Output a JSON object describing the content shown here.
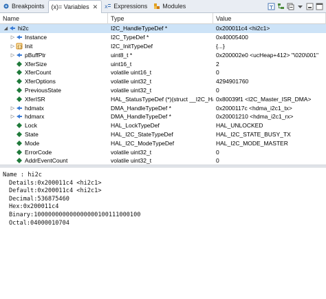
{
  "tabs": [
    {
      "label": "Breakpoints",
      "icon": "breakpoint-icon",
      "active": false
    },
    {
      "label": "(x)= Variables",
      "icon": "variables-icon",
      "active": true,
      "close": "✕"
    },
    {
      "label": "Expressions",
      "icon": "expressions-icon",
      "active": false
    },
    {
      "label": "Modules",
      "icon": "modules-icon",
      "active": false
    }
  ],
  "toolbar": [
    "show-type-names-icon",
    "show-logical-structure-icon",
    "collapse-all-icon",
    "new-window-icon",
    "minimize-icon",
    "maximize-icon"
  ],
  "columns": {
    "name": "Name",
    "type": "Type",
    "value": "Value"
  },
  "rows": [
    {
      "depth": 0,
      "arrow": "◢",
      "icon": "pointer",
      "name": "hi2c",
      "type": "I2C_HandleTypeDef *",
      "value": "0x200011c4 <hi2c1>",
      "selected": true
    },
    {
      "depth": 1,
      "arrow": "▷",
      "icon": "pointer",
      "name": "Instance",
      "type": "I2C_TypeDef *",
      "value": "0x40005400"
    },
    {
      "depth": 1,
      "arrow": "▷",
      "icon": "struct",
      "name": "Init",
      "type": "I2C_InitTypeDef",
      "value": "{...}"
    },
    {
      "depth": 1,
      "arrow": "▷",
      "icon": "pointer",
      "name": "pBuffPtr",
      "type": "uint8_t *",
      "value": "0x200002e0 <ucHeap+412> \"\\020\\001\""
    },
    {
      "depth": 1,
      "arrow": "",
      "icon": "field",
      "name": "XferSize",
      "type": "uint16_t",
      "value": "2"
    },
    {
      "depth": 1,
      "arrow": "",
      "icon": "field",
      "name": "XferCount",
      "type": "volatile uint16_t",
      "value": "0"
    },
    {
      "depth": 1,
      "arrow": "",
      "icon": "field",
      "name": "XferOptions",
      "type": "volatile uint32_t",
      "value": "4294901760"
    },
    {
      "depth": 1,
      "arrow": "",
      "icon": "field",
      "name": "PreviousState",
      "type": "volatile uint32_t",
      "value": "0"
    },
    {
      "depth": 1,
      "arrow": "",
      "icon": "field",
      "name": "XferISR",
      "type": "HAL_StatusTypeDef (*)(struct __I2C_Ha...",
      "value": "0x80039f1 <I2C_Master_ISR_DMA>"
    },
    {
      "depth": 1,
      "arrow": "▷",
      "icon": "pointer",
      "name": "hdmatx",
      "type": "DMA_HandleTypeDef *",
      "value": "0x2000117c <hdma_i2c1_tx>"
    },
    {
      "depth": 1,
      "arrow": "▷",
      "icon": "pointer",
      "name": "hdmarx",
      "type": "DMA_HandleTypeDef *",
      "value": "0x20001210 <hdma_i2c1_rx>"
    },
    {
      "depth": 1,
      "arrow": "",
      "icon": "field",
      "name": "Lock",
      "type": "HAL_LockTypeDef",
      "value": "HAL_UNLOCKED"
    },
    {
      "depth": 1,
      "arrow": "",
      "icon": "field",
      "name": "State",
      "type": "HAL_I2C_StateTypeDef",
      "value": "HAL_I2C_STATE_BUSY_TX"
    },
    {
      "depth": 1,
      "arrow": "",
      "icon": "field",
      "name": "Mode",
      "type": "HAL_I2C_ModeTypeDef",
      "value": "HAL_I2C_MODE_MASTER"
    },
    {
      "depth": 1,
      "arrow": "",
      "icon": "field",
      "name": "ErrorCode",
      "type": "volatile uint32_t",
      "value": "0"
    },
    {
      "depth": 1,
      "arrow": "",
      "icon": "field",
      "name": "AddrEventCount",
      "type": "volatile uint32_t",
      "value": "0"
    }
  ],
  "details": [
    {
      "text": "Name : hi2c",
      "indent": false
    },
    {
      "text": "Details:0x200011c4 <hi2c1>",
      "indent": true
    },
    {
      "text": "Default:0x200011c4 <hi2c1>",
      "indent": true
    },
    {
      "text": "Decimal:536875460",
      "indent": true
    },
    {
      "text": "Hex:0x200011c4",
      "indent": true
    },
    {
      "text": "Binary:100000000000000000100111000100",
      "indent": true
    },
    {
      "text": "Octal:04000010704",
      "indent": true
    }
  ],
  "colors": {
    "selection": "#cde3f7",
    "pointer_icon": "#3a7bd5",
    "field_icon": "#1f7a3a",
    "struct_icon": "#d08a1a"
  }
}
